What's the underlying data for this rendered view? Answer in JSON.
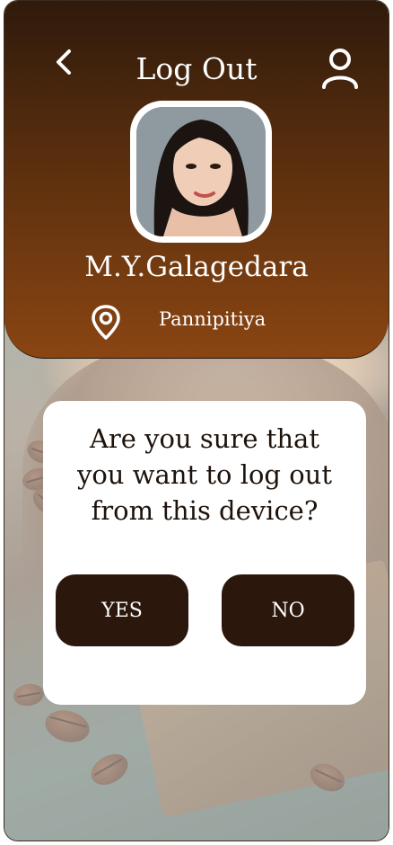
{
  "header": {
    "title": "Log Out",
    "back_icon": "chevron-left-icon",
    "user_icon": "user-icon"
  },
  "profile": {
    "name": "M.Y.Galagedara",
    "location_icon": "location-pin-icon",
    "location": "Pannipitiya"
  },
  "dialog": {
    "question": "Are you sure that\nyou want to log out\nfrom this device?",
    "yes_label": "YES",
    "no_label": "NO"
  },
  "colors": {
    "header_top": "#2f1a0b",
    "header_bottom": "#8a4512",
    "button": "#2b170b",
    "dialog": "#ffffff"
  }
}
